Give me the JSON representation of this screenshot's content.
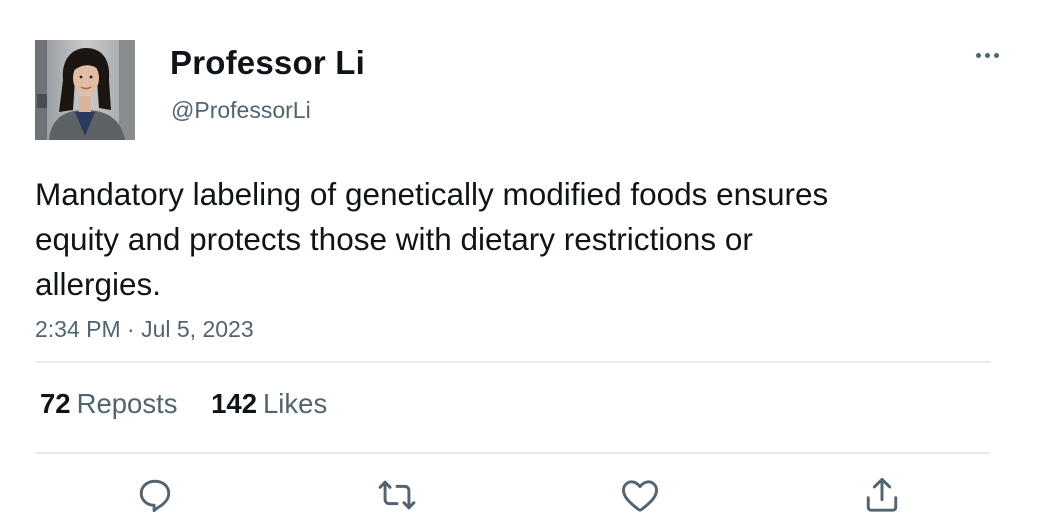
{
  "author": {
    "display_name": "Professor Li",
    "handle": "@ProfessorLi",
    "avatar_icon": "profile-photo"
  },
  "tweet": {
    "text": "Mandatory labeling of genetically modified foods ensures equity and protects those with dietary restrictions or allergies.",
    "timestamp": "2:34 PM · Jul 5, 2023"
  },
  "stats": {
    "reposts_count": "72",
    "reposts_label": "Reposts",
    "likes_count": "142",
    "likes_label": "Likes"
  },
  "actions": [
    {
      "icon": "reply-icon"
    },
    {
      "icon": "repost-icon"
    },
    {
      "icon": "like-icon"
    },
    {
      "icon": "share-icon"
    }
  ],
  "colors": {
    "text_primary": "#0f1419",
    "text_secondary": "#536471",
    "divider": "#e7eaec",
    "icon": "#536471"
  }
}
